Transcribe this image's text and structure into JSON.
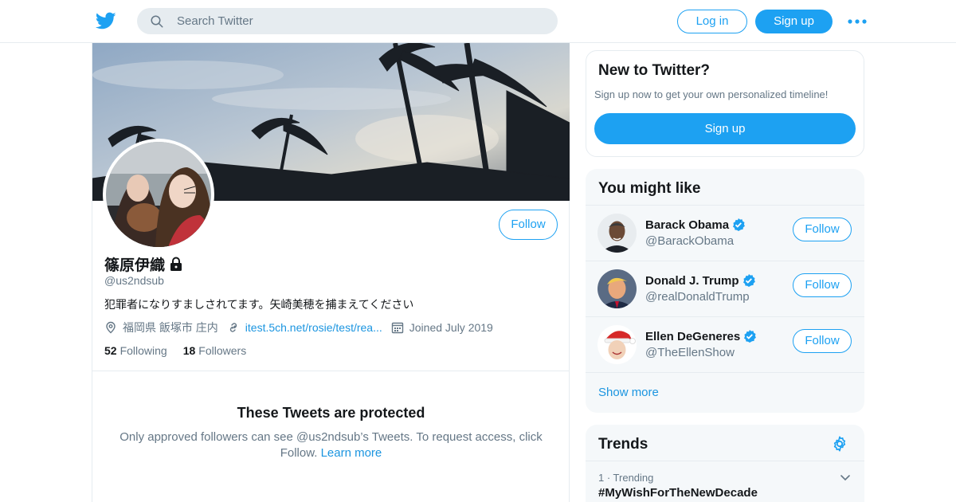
{
  "header": {
    "logo_icon": "twitter-bird-icon",
    "search_placeholder": "Search Twitter",
    "login_label": "Log in",
    "signup_label": "Sign up",
    "more_icon": "more-dots-icon",
    "brand_color": "#1da1f2"
  },
  "profile": {
    "display_name": "篠原伊織",
    "protected_icon": "lock-icon",
    "handle": "@us2ndsub",
    "bio": "犯罪者になりすましされてます。矢崎美穂を捕まえてください",
    "location": "福岡県 飯塚市 庄内",
    "website": "itest.5ch.net/rosie/test/rea...",
    "joined": "Joined July 2019",
    "following_count": "52",
    "following_label": "Following",
    "followers_count": "18",
    "followers_label": "Followers",
    "follow_label": "Follow"
  },
  "protected": {
    "title": "These Tweets are protected",
    "text": "Only approved followers can see @us2ndsub’s Tweets. To request access, click Follow.",
    "learn_more": "Learn more"
  },
  "new_to_twitter": {
    "title": "New to Twitter?",
    "subtitle": "Sign up now to get your own personalized timeline!",
    "signup_label": "Sign up"
  },
  "you_might_like": {
    "title": "You might like",
    "items": [
      {
        "name": "Barack Obama",
        "handle": "@BarackObama",
        "follow_label": "Follow",
        "verified": true
      },
      {
        "name": "Donald J. Trump",
        "handle": "@realDonaldTrump",
        "follow_label": "Follow",
        "verified": true
      },
      {
        "name": "Ellen DeGeneres",
        "handle": "@TheEllenShow",
        "follow_label": "Follow",
        "verified": true
      }
    ],
    "show_more": "Show more"
  },
  "trends": {
    "title": "Trends",
    "settings_icon": "gear-icon",
    "items": [
      {
        "meta": "1 · Trending",
        "tag": "#MyWishForTheNewDecade"
      }
    ]
  }
}
